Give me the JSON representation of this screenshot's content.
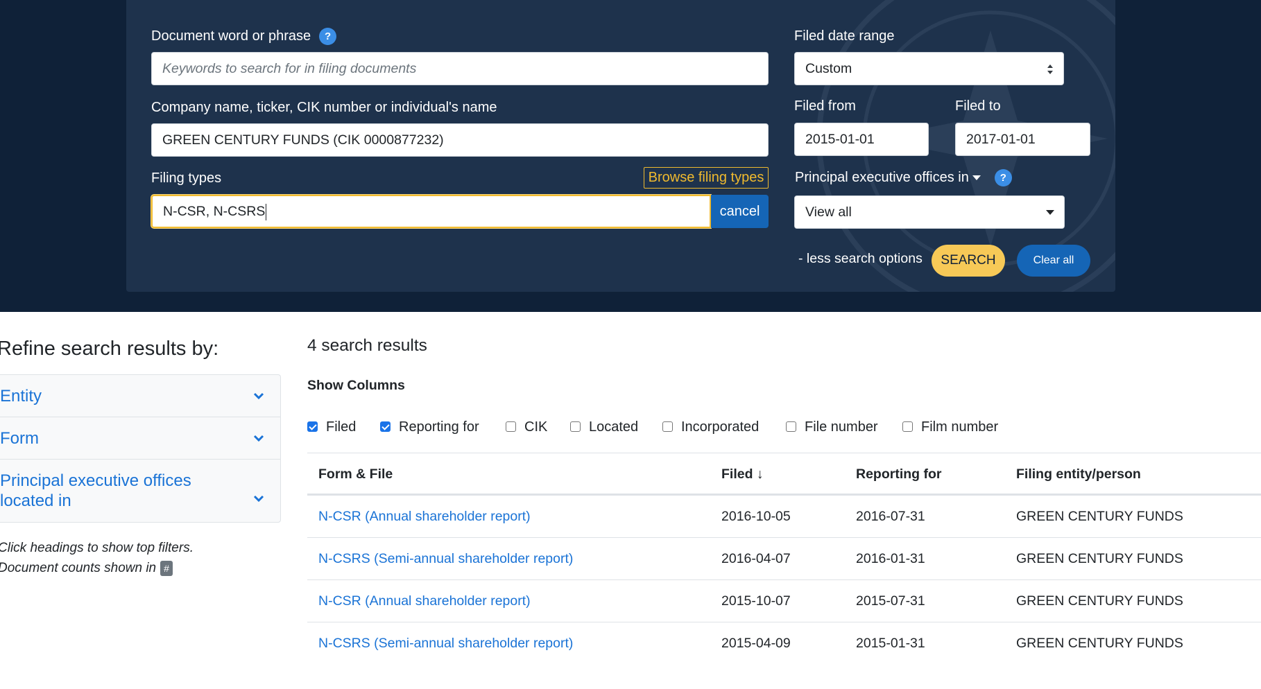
{
  "search": {
    "keywords_label": "Document word or phrase",
    "keywords_placeholder": "Keywords to search for in filing documents",
    "entity_label": "Company name, ticker, CIK number or individual's name",
    "entity_value": "GREEN CENTURY FUNDS (CIK 0000877232)",
    "filing_types_label": "Filing types",
    "browse_filing_types": "Browse filing types",
    "filing_types_value": "N-CSR, N-CSRS",
    "cancel_label": "cancel",
    "date_range_label": "Filed date range",
    "date_range_value": "Custom",
    "filed_from_label": "Filed from",
    "filed_from_value": "2015-01-01",
    "filed_to_label": "Filed to",
    "filed_to_value": "2017-01-01",
    "peo_label": "Principal executive offices in",
    "peo_value": "View all",
    "less_options": "- less search options",
    "search_button": "SEARCH",
    "clear_button": "Clear all"
  },
  "refine": {
    "title": "Refine search results by:",
    "facets": [
      {
        "label": "Entity"
      },
      {
        "label": "Form"
      },
      {
        "label_line1": "Principal executive offices",
        "label_line2": "located in"
      }
    ],
    "hint_line1": "Click headings to show top filters.",
    "hint_line2": "Document counts shown in",
    "hint_badge": "#"
  },
  "results": {
    "count_text": "4 search results",
    "show_columns": "Show Columns",
    "columns": [
      {
        "label": "Filed",
        "checked": true
      },
      {
        "label": "Reporting for",
        "checked": true
      },
      {
        "label": "CIK",
        "checked": false
      },
      {
        "label": "Located",
        "checked": false
      },
      {
        "label": "Incorporated",
        "checked": false
      },
      {
        "label": "File number",
        "checked": false
      },
      {
        "label": "Film number",
        "checked": false
      }
    ],
    "headers": [
      "Form & File",
      "Filed ↓",
      "Reporting for",
      "Filing entity/person"
    ],
    "rows": [
      {
        "form": "N-CSR (Annual shareholder report)",
        "filed": "2016-10-05",
        "reporting": "2016-07-31",
        "entity": "GREEN CENTURY FUNDS"
      },
      {
        "form": "N-CSRS (Semi-annual shareholder report)",
        "filed": "2016-04-07",
        "reporting": "2016-01-31",
        "entity": "GREEN CENTURY FUNDS"
      },
      {
        "form": "N-CSR (Annual shareholder report)",
        "filed": "2015-10-07",
        "reporting": "2015-07-31",
        "entity": "GREEN CENTURY FUNDS"
      },
      {
        "form": "N-CSRS (Semi-annual shareholder report)",
        "filed": "2015-04-09",
        "reporting": "2015-01-31",
        "entity": "GREEN CENTURY FUNDS"
      }
    ]
  },
  "colors": {
    "page_bg_dark": "#0f2138",
    "panel_bg": "#1e324c",
    "accent_yellow": "#f7c957",
    "primary_blue": "#1565b6",
    "link_blue": "#1a73d6"
  }
}
